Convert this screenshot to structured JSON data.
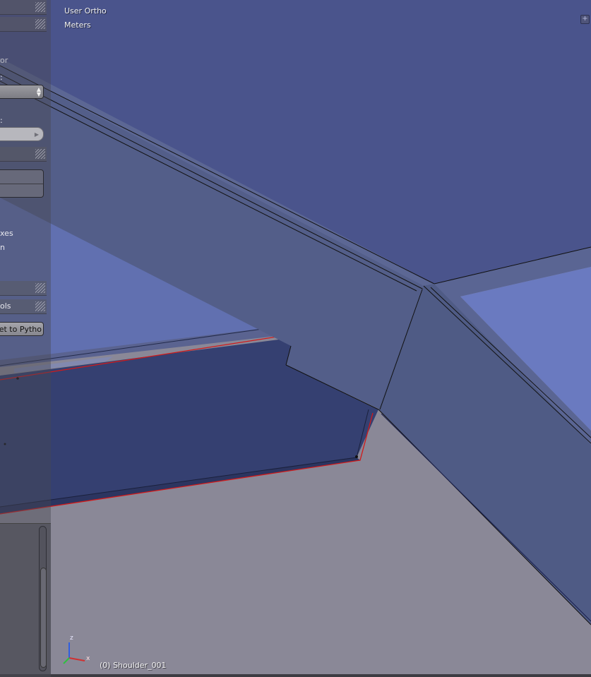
{
  "viewport": {
    "view_mode": "User Ortho",
    "units": "Meters",
    "object_label": "(0) Shoulder_001",
    "axes": {
      "x": "x",
      "z": "z"
    }
  },
  "toolshelf": {
    "frag_or": "or",
    "frag_colon1": ":",
    "frag_colon2": ":",
    "frag_xes": "xes",
    "frag_n": "n",
    "frag_ols": "ols",
    "py_button_label": "dget to Pytho"
  },
  "colors": {
    "upper_plane": "#4a548c",
    "beam_face": "#4f5b85",
    "selected_edge": "#d11a1a",
    "floor": "#8a8897"
  },
  "icons": {
    "corner_widget": "plus-icon",
    "select_arrows": "updown-arrows-icon"
  }
}
